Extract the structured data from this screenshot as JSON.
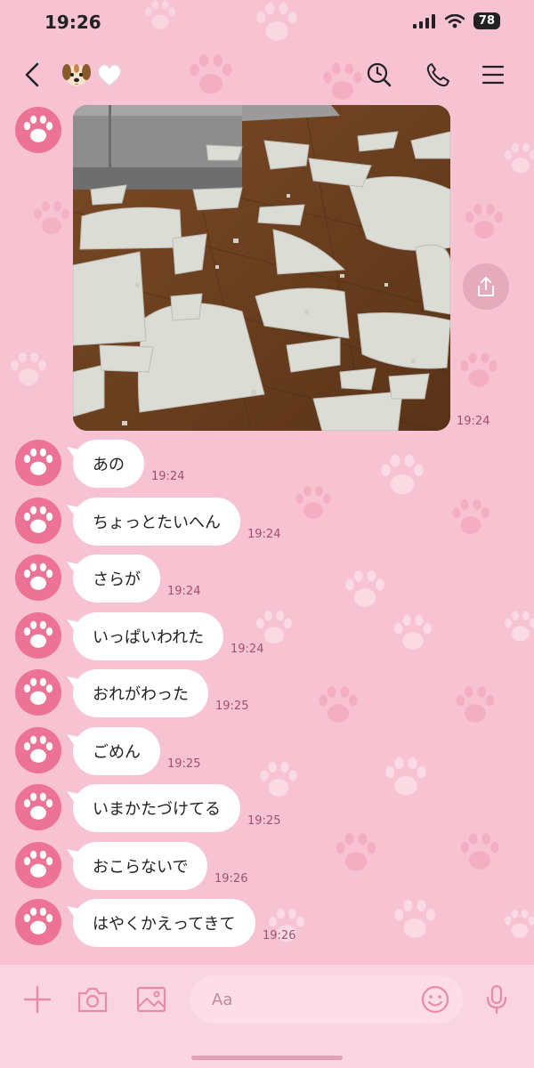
{
  "status_bar": {
    "time": "19:26",
    "battery": "78"
  },
  "header": {
    "title_emojis": [
      "🐶",
      "🤍"
    ],
    "icons": [
      "back-arrow",
      "clock-search",
      "phone",
      "menu"
    ]
  },
  "photo": {
    "time": "19:24",
    "alt": "broken plates on floor"
  },
  "messages": [
    {
      "text": "あの",
      "time": "19:24"
    },
    {
      "text": "ちょっとたいへん",
      "time": "19:24"
    },
    {
      "text": "さらが",
      "time": "19:24"
    },
    {
      "text": "いっぱいわれた",
      "time": "19:24"
    },
    {
      "text": "おれがわった",
      "time": "19:25"
    },
    {
      "text": "ごめん",
      "time": "19:25"
    },
    {
      "text": "いまかたづけてる",
      "time": "19:25"
    },
    {
      "text": "おこらないで",
      "time": "19:26"
    },
    {
      "text": "はやくかえってきて",
      "time": "19:26"
    }
  ],
  "input": {
    "placeholder": "Aa"
  },
  "colors": {
    "background": "#f7c3d3",
    "avatar": "#ec7296",
    "time_text": "#a1506b",
    "bubble": "#ffffff"
  }
}
